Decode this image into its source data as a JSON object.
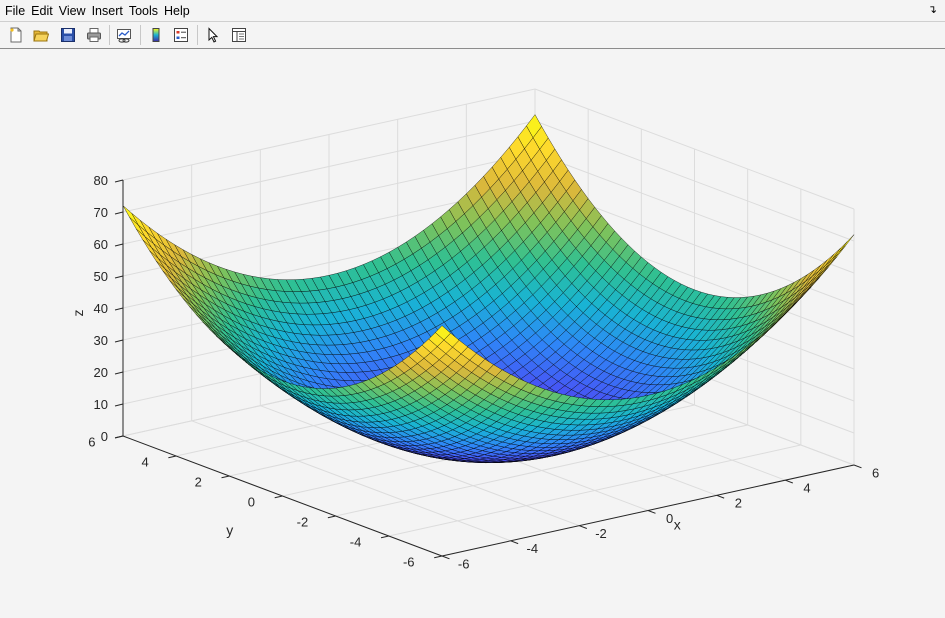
{
  "menu": {
    "items": [
      "File",
      "Edit",
      "View",
      "Insert",
      "Tools",
      "Help"
    ],
    "dock_icon": "dock-arrow-icon"
  },
  "toolbar": {
    "buttons": [
      {
        "name": "new-figure-button",
        "icon": "new-file-icon"
      },
      {
        "name": "open-file-button",
        "icon": "open-folder-icon"
      },
      {
        "name": "save-figure-button",
        "icon": "save-icon"
      },
      {
        "name": "print-figure-button",
        "icon": "print-icon"
      },
      {
        "name": "link-plot-button",
        "icon": "link-plot-icon"
      },
      {
        "name": "insert-colorbar-button",
        "icon": "colorbar-icon"
      },
      {
        "name": "insert-legend-button",
        "icon": "legend-icon"
      },
      {
        "name": "edit-plot-button",
        "icon": "pointer-icon"
      },
      {
        "name": "property-inspector-button",
        "icon": "property-inspector-icon"
      }
    ]
  },
  "chart_data": {
    "type": "surface",
    "function": "z = x^2 + y^2",
    "title": "",
    "xlabel": "x",
    "ylabel": "y",
    "zlabel": "z",
    "xlim": [
      -6,
      6
    ],
    "ylim": [
      -6,
      6
    ],
    "zlim": [
      0,
      80
    ],
    "xticks": [
      -6,
      -4,
      -2,
      0,
      2,
      4,
      6
    ],
    "yticks": [
      -6,
      -4,
      -2,
      0,
      2,
      4,
      6
    ],
    "zticks": [
      0,
      10,
      20,
      30,
      40,
      50,
      60,
      70,
      80
    ],
    "x_labels": [
      "-6",
      "-4",
      "-2",
      "0",
      "2",
      "4",
      "6"
    ],
    "y_labels": [
      "-6",
      "-4",
      "-2",
      "0",
      "2",
      "4",
      "6"
    ],
    "z_labels": [
      "0",
      "10",
      "20",
      "30",
      "40",
      "50",
      "60",
      "70",
      "80"
    ],
    "grid": true,
    "colormap": "parula",
    "colormap_stops": [
      "#3e26a8",
      "#4755f5",
      "#2e87f7",
      "#19b3d4",
      "#2ec094",
      "#80c25a",
      "#dcb83b",
      "#fdd82d",
      "#f9fb14"
    ],
    "edge_color": "#000000",
    "mesh_steps": 48,
    "corner_values": [
      {
        "x": -6,
        "y": -6,
        "z": 72
      },
      {
        "x": 6,
        "y": -6,
        "z": 72
      },
      {
        "x": 6,
        "y": 6,
        "z": 72
      },
      {
        "x": -6,
        "y": 6,
        "z": 72
      }
    ],
    "min_value": {
      "x": 0,
      "y": 0,
      "z": 0
    }
  }
}
